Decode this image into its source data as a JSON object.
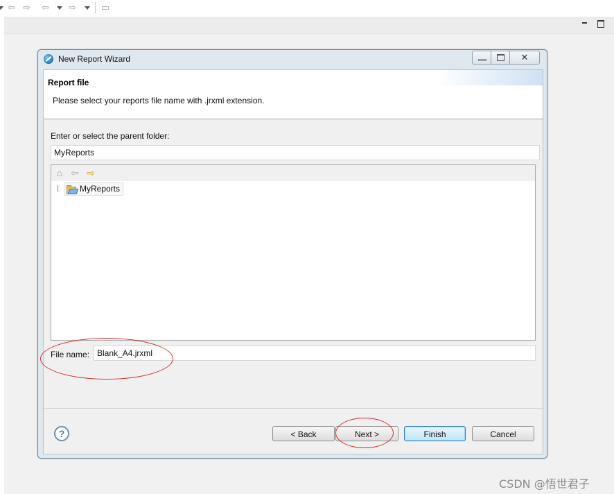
{
  "window": {
    "title": "New Report Wizard"
  },
  "toolbar": {
    "icons": [
      "history-back-icon",
      "history-forward-icon",
      "nav-back-icon",
      "nav-forward-icon",
      "new-window-icon"
    ]
  },
  "banner": {
    "title": "Report file",
    "description": "Please select your reports file name with .jrxml extension."
  },
  "parent_folder": {
    "label": "Enter or select the parent folder:",
    "value": "MyReports"
  },
  "tree": {
    "toolbar_icons": [
      "home-icon",
      "back-icon",
      "forward-icon"
    ],
    "items": [
      {
        "label": "MyReports",
        "expanded": false,
        "icon": "open-folder-icon"
      }
    ]
  },
  "file_name": {
    "label": "File name:",
    "value": "Blank_A4.jrxml"
  },
  "buttons": {
    "help": "?",
    "back": "< Back",
    "next": "Next >",
    "finish": "Finish",
    "cancel": "Cancel"
  },
  "window_controls": {
    "close": "✕"
  },
  "watermark": "CSDN @悟世君子",
  "colors": {
    "annotation": "#d42b2b",
    "finish_border": "#3c7fb1"
  }
}
